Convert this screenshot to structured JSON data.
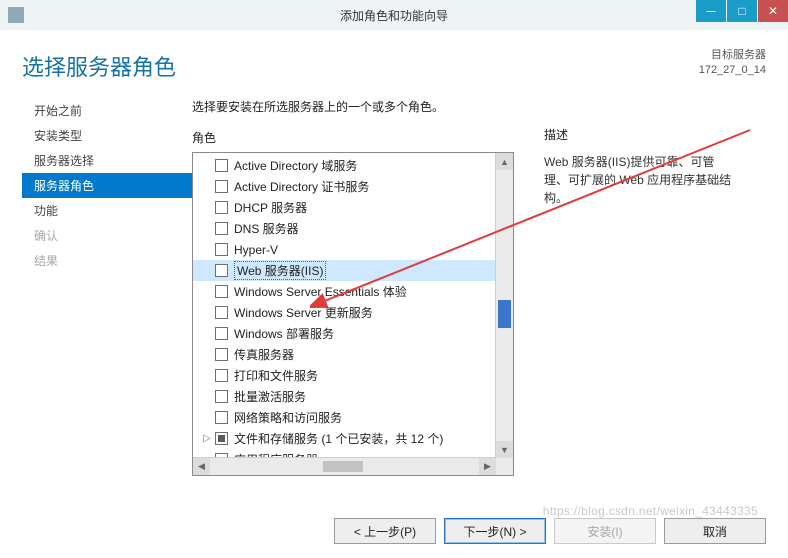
{
  "window": {
    "title": "添加角色和功能向导"
  },
  "header": {
    "page_title": "选择服务器角色",
    "target_label": "目标服务器",
    "target_value": "172_27_0_14"
  },
  "nav": {
    "items": [
      {
        "label": "开始之前",
        "state": "normal"
      },
      {
        "label": "安装类型",
        "state": "normal"
      },
      {
        "label": "服务器选择",
        "state": "normal"
      },
      {
        "label": "服务器角色",
        "state": "selected"
      },
      {
        "label": "功能",
        "state": "normal"
      },
      {
        "label": "确认",
        "state": "disabled"
      },
      {
        "label": "结果",
        "state": "disabled"
      }
    ]
  },
  "main": {
    "instruction": "选择要安装在所选服务器上的一个或多个角色。",
    "roles_label": "角色",
    "roles": [
      {
        "label": "Active Directory 域服务",
        "checked": "none"
      },
      {
        "label": "Active Directory 证书服务",
        "checked": "none"
      },
      {
        "label": "DHCP 服务器",
        "checked": "none"
      },
      {
        "label": "DNS 服务器",
        "checked": "none"
      },
      {
        "label": "Hyper-V",
        "checked": "none"
      },
      {
        "label": "Web 服务器(IIS)",
        "checked": "none",
        "highlight": true
      },
      {
        "label": "Windows Server Essentials 体验",
        "checked": "none"
      },
      {
        "label": "Windows Server 更新服务",
        "checked": "none"
      },
      {
        "label": "Windows 部署服务",
        "checked": "none"
      },
      {
        "label": "传真服务器",
        "checked": "none"
      },
      {
        "label": "打印和文件服务",
        "checked": "none"
      },
      {
        "label": "批量激活服务",
        "checked": "none"
      },
      {
        "label": "网络策略和访问服务",
        "checked": "none"
      },
      {
        "label": "文件和存储服务 (1 个已安装，共 12 个)",
        "checked": "partial",
        "expandable": true
      },
      {
        "label": "应用程序服务器",
        "checked": "none"
      }
    ],
    "desc_label": "描述",
    "desc_text": "Web 服务器(IIS)提供可靠、可管理、可扩展的 Web 应用程序基础结构。"
  },
  "footer": {
    "prev": "< 上一步(P)",
    "next": "下一步(N) >",
    "install": "安装(I)",
    "cancel": "取消"
  },
  "watermark": "https://blog.csdn.net/weixin_43443335"
}
